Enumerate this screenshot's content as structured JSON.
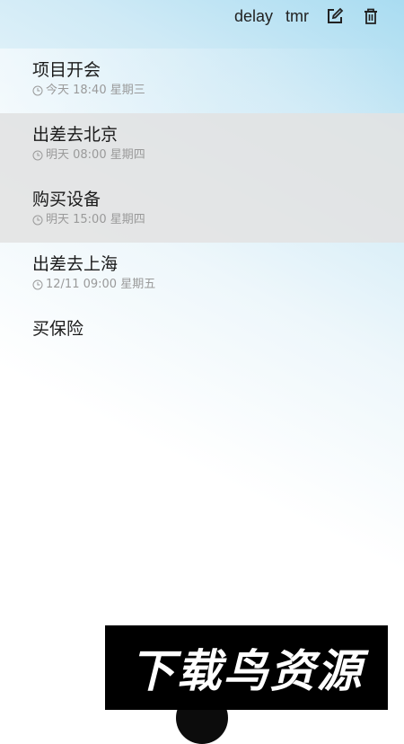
{
  "toolbar": {
    "delay_label": "delay",
    "tmr_label": "tmr",
    "edit_icon": "edit-icon",
    "delete_icon": "trash-icon"
  },
  "items": [
    {
      "title": "项目开会",
      "time": "今天 18:40 星期三"
    },
    {
      "title": "出差去北京",
      "time": "明天 08:00 星期四"
    },
    {
      "title": "购买设备",
      "time": "明天 15:00 星期四"
    },
    {
      "title": "出差去上海",
      "time": "12/11 09:00 星期五"
    },
    {
      "title": "买保险",
      "time": ""
    }
  ],
  "watermark": {
    "text": "下载鸟资源"
  },
  "colors": {
    "gradient_top": "#a9dcf1",
    "highlight_gray": "#e2e2e2",
    "subtext": "#9a9a9a"
  }
}
